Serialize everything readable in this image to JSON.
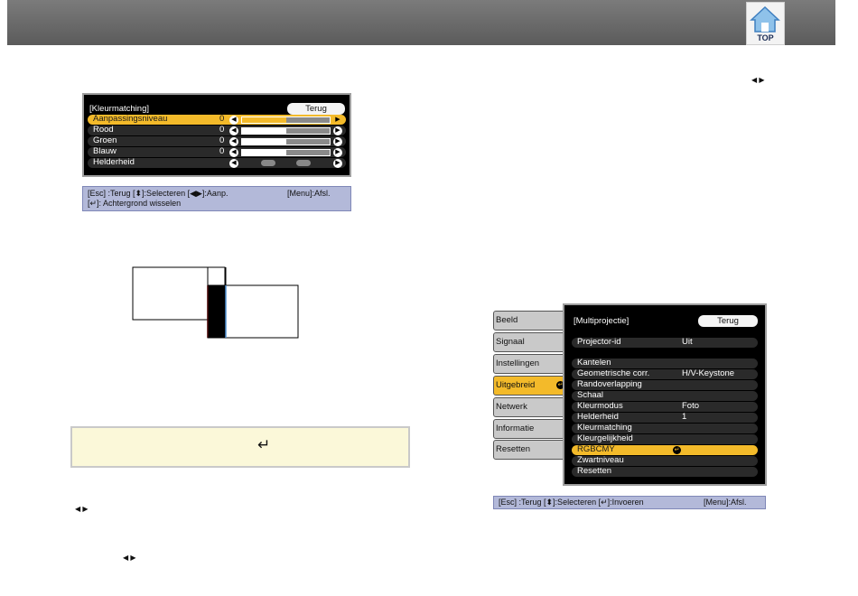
{
  "header": {
    "top_label": "TOP"
  },
  "color_matching": {
    "title": "[Kleurmatching]",
    "back": "Terug",
    "rows": [
      {
        "label": "Aanpassingsniveau",
        "value": "0"
      },
      {
        "label": "Rood",
        "value": "0"
      },
      {
        "label": "Groen",
        "value": "0"
      },
      {
        "label": "Blauw",
        "value": "0"
      },
      {
        "label": "Helderheid"
      }
    ],
    "help_line1": "[Esc] :Terug [⬍]:Selecteren [◀▶]:Aanp.",
    "help_menu": "[Menu]:Afsl.",
    "help_line2": "[↵]: Achtergrond wisselen"
  },
  "multiprojection": {
    "sidebar": [
      "Beeld",
      "Signaal",
      "Instellingen",
      "Uitgebreid",
      "Netwerk",
      "Informatie",
      "Resetten"
    ],
    "title": "[Multiprojectie]",
    "back": "Terug",
    "rows": [
      {
        "label": "Projector-id",
        "value": "Uit"
      },
      {
        "label": "Kantelen",
        "value": ""
      },
      {
        "label": "Geometrische corr.",
        "value": "H/V-Keystone"
      },
      {
        "label": "Randoverlapping",
        "value": ""
      },
      {
        "label": "Schaal",
        "value": ""
      },
      {
        "label": "Kleurmodus",
        "value": "Foto"
      },
      {
        "label": "Helderheid",
        "value": "1"
      },
      {
        "label": "Kleurmatching",
        "value": ""
      },
      {
        "label": "Kleurgelijkheid",
        "value": ""
      },
      {
        "label": "RGBCMY",
        "value": ""
      },
      {
        "label": "Zwartniveau",
        "value": ""
      },
      {
        "label": "Resetten",
        "value": ""
      }
    ],
    "help_left": "[Esc] :Terug [⬍]:Selecteren [↵]:Invoeren",
    "help_right": "[Menu]:Afsl."
  },
  "tip": {
    "symbol": "↵"
  },
  "arrows": "◀ ▶"
}
